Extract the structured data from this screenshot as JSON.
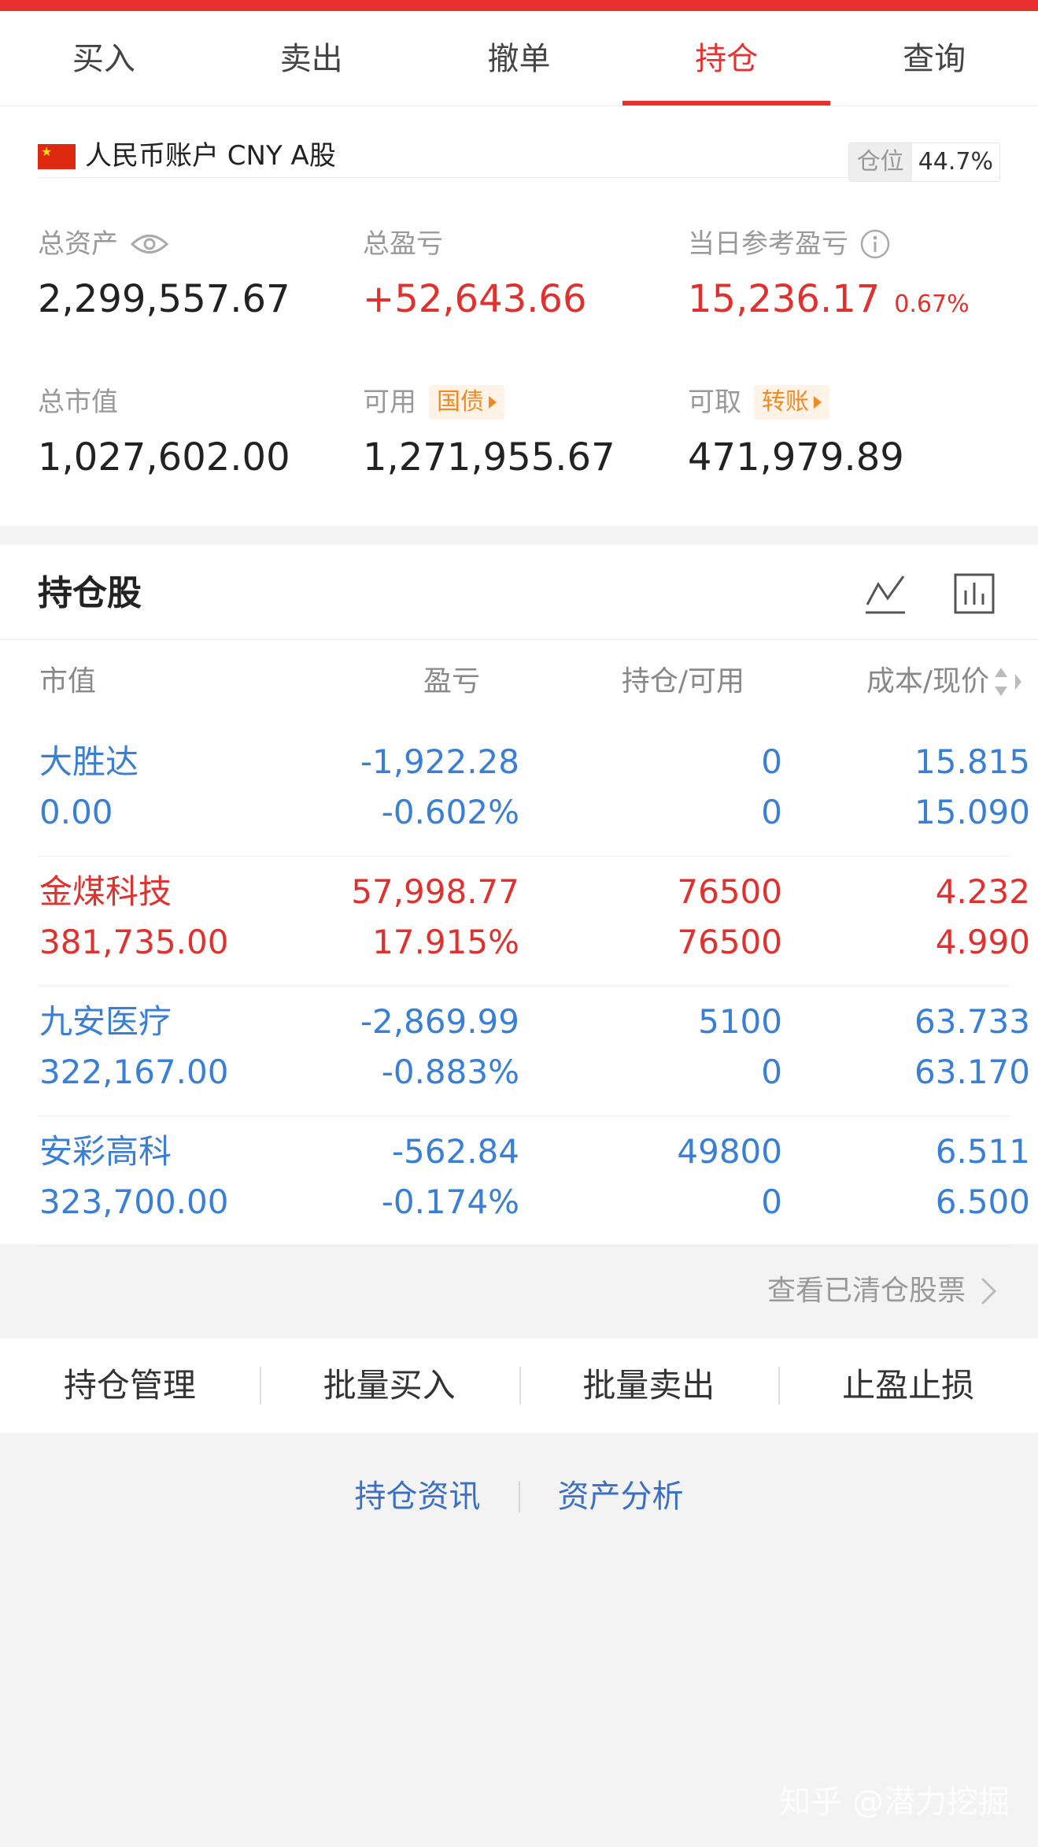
{
  "tabs": [
    "买入",
    "卖出",
    "撤单",
    "持仓",
    "查询"
  ],
  "active_tab": 3,
  "account": {
    "name": "人民币账户 CNY A股",
    "position_label": "仓位",
    "position_value": "44.7%"
  },
  "stats": {
    "total_assets": {
      "label": "总资产",
      "value": "2,299,557.67"
    },
    "total_pnl": {
      "label": "总盈亏",
      "value": "+52,643.66"
    },
    "daily_pnl": {
      "label": "当日参考盈亏",
      "value": "15,236.17",
      "pct": "0.67%"
    },
    "market_value": {
      "label": "总市值",
      "value": "1,027,602.00"
    },
    "available": {
      "label": "可用",
      "tag": "国债",
      "value": "1,271,955.67"
    },
    "withdrawable": {
      "label": "可取",
      "tag": "转账",
      "value": "471,979.89"
    }
  },
  "holdings": {
    "title": "持仓股",
    "columns": [
      "市值",
      "盈亏",
      "持仓/可用",
      "成本/现价"
    ],
    "rows": [
      {
        "name": "大胜达",
        "market_value": "0.00",
        "pnl": "-1,922.28",
        "pnl_pct": "-0.602%",
        "position": "0",
        "available": "0",
        "cost": "15.815",
        "price": "15.090",
        "color": "#3a7fd6"
      },
      {
        "name": "金煤科技",
        "market_value": "381,735.00",
        "pnl": "57,998.77",
        "pnl_pct": "17.915%",
        "position": "76500",
        "available": "76500",
        "cost": "4.232",
        "price": "4.990",
        "color": "#e0312e"
      },
      {
        "name": "九安医疗",
        "market_value": "322,167.00",
        "pnl": "-2,869.99",
        "pnl_pct": "-0.883%",
        "position": "5100",
        "available": "0",
        "cost": "63.733",
        "price": "63.170",
        "color": "#3a7fd6"
      },
      {
        "name": "安彩高科",
        "market_value": "323,700.00",
        "pnl": "-562.84",
        "pnl_pct": "-0.174%",
        "position": "49800",
        "available": "0",
        "cost": "6.511",
        "price": "6.500",
        "color": "#3a7fd6"
      }
    ],
    "cleared_link": "查看已清仓股票"
  },
  "actions": [
    "持仓管理",
    "批量买入",
    "批量卖出",
    "止盈止损"
  ],
  "links": [
    "持仓资讯",
    "资产分析"
  ],
  "watermark": "知乎 @潜力挖掘",
  "colors": {
    "accent": "#e8312f",
    "up": "#e0312e",
    "down": "#3a7fd6",
    "tag": "#f18a22",
    "link": "#3a6fc8"
  }
}
